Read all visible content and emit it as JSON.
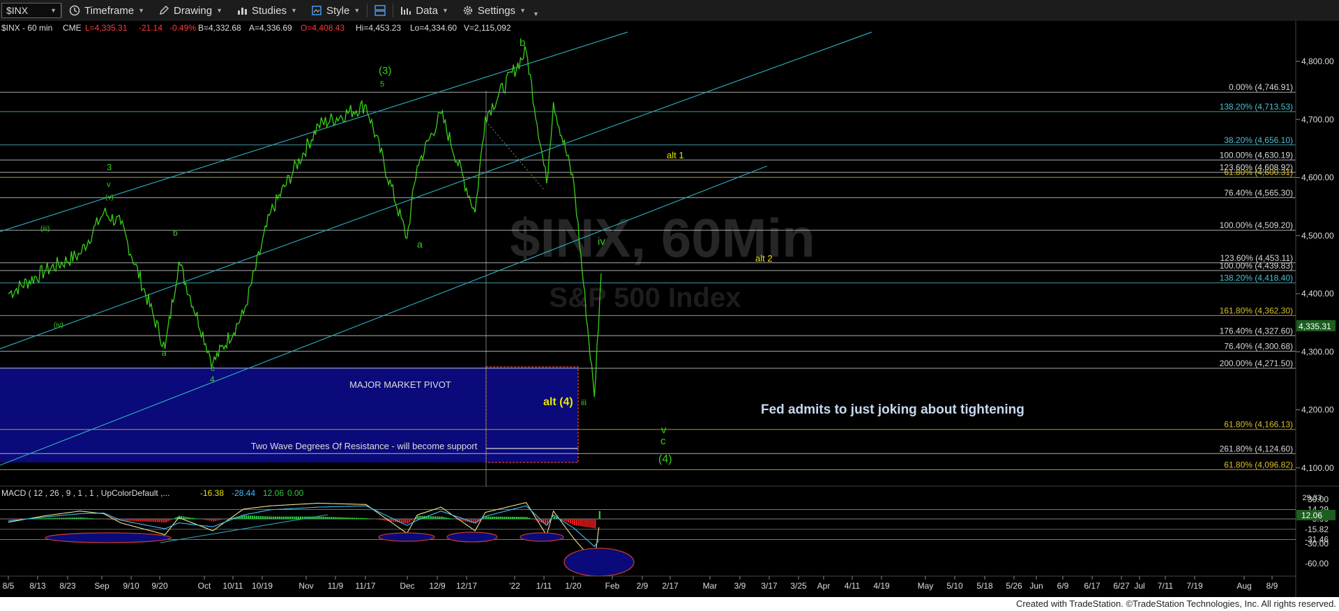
{
  "toolbar": {
    "symbol": "$INX",
    "timeframe": "Timeframe",
    "drawing": "Drawing",
    "studies": "Studies",
    "style": "Style",
    "data": "Data",
    "settings": "Settings"
  },
  "header_line": {
    "symbol": "$INX - 60 min",
    "exchange": "CME",
    "last": "L=4,335.31",
    "change": "-21.14",
    "change_pct": "-0.49%",
    "bid": "B=4,332.68",
    "ask": "A=4,336.69",
    "open": "O=4,408.43",
    "high": "Hi=4,453.23",
    "low": "Lo=4,334.60",
    "volume": "V=2,115,092"
  },
  "watermark": {
    "line1": "$INX, 60Min",
    "line2": "S&P 500 Index"
  },
  "colors": {
    "background": "#000000",
    "price": "#39d017",
    "wave_label": "#39d017",
    "alt_label": "#e6e600",
    "channel": "#2aa6b8",
    "pivot_box": "#0a0a7a",
    "pivot_border": "#c0392b",
    "fib_white": "#d8d8d8",
    "fib_cyan": "#4fc0d0",
    "fib_yellow": "#d7c02a",
    "macd_line": "#3fbfff",
    "macd_signal": "#f0e68c",
    "hist_up": "#2ecc40",
    "hist_down": "#e82020"
  },
  "price_axis": {
    "labels": [
      "4,800.00",
      "4,700.00",
      "4,600.00",
      "4,500.00",
      "4,400.00",
      "4,300.00",
      "4,200.00",
      "4,100.00"
    ],
    "current": "4,335.31"
  },
  "macd_axis": {
    "labels": [
      "30.00",
      "14.29",
      "0.00",
      "-15.82",
      "-31.46",
      "-30.00",
      "-60.00"
    ],
    "current": "12.06",
    "top_cut": "29.33"
  },
  "macd_header": {
    "title": "MACD ( 12 , 26 , 9 , 1 , 1 , UpColorDefault ,...",
    "macd": "-16.38",
    "signal": "-28.44",
    "hist": "12.06",
    "zero": "0.00"
  },
  "date_axis": [
    "8/5",
    "8/13",
    "8/23",
    "Sep",
    "9/10",
    "9/20",
    "Oct",
    "10/11",
    "10/19",
    "Nov",
    "11/9",
    "11/17",
    "Dec",
    "12/9",
    "12/17",
    "'22",
    "1/11",
    "1/20",
    "Feb",
    "2/9",
    "2/17",
    "Mar",
    "3/9",
    "3/17",
    "3/25",
    "Apr",
    "4/11",
    "4/19",
    "May",
    "5/10",
    "5/18",
    "5/26",
    "Jun",
    "6/9",
    "6/17",
    "6/27",
    "Jul",
    "7/11",
    "7/19",
    "Aug",
    "8/9"
  ],
  "fib_levels": [
    {
      "text": "0.00% (4,746.91)",
      "value": 4746.91,
      "color": "white"
    },
    {
      "text": "138.20% (4,713.53)",
      "value": 4713.53,
      "color": "cyan"
    },
    {
      "text": "38.20% (4,656.10)",
      "value": 4656.1,
      "color": "cyan"
    },
    {
      "text": "100.00% (4,630.19)",
      "value": 4630.19,
      "color": "white"
    },
    {
      "text": "123.60% (4,608.92)",
      "value": 4608.92,
      "color": "white"
    },
    {
      "text": "61.80% (4,600.31)",
      "value": 4600.31,
      "color": "yellow"
    },
    {
      "text": "76.40% (4,565.30)",
      "value": 4565.3,
      "color": "white"
    },
    {
      "text": "100.00% (4,509.20)",
      "value": 4509.2,
      "color": "white"
    },
    {
      "text": "123.60% (4,453.11)",
      "value": 4453.11,
      "color": "white"
    },
    {
      "text": "100.00% (4,439.83)",
      "value": 4439.83,
      "color": "white"
    },
    {
      "text": "138.20% (4,418.40)",
      "value": 4418.4,
      "color": "cyan"
    },
    {
      "text": "161.80% (4,362.30)",
      "value": 4362.3,
      "color": "yellow"
    },
    {
      "text": "176.40% (4,327.60)",
      "value": 4327.6,
      "color": "white"
    },
    {
      "text": "76.40% (4,300.68)",
      "value": 4300.68,
      "color": "white"
    },
    {
      "text": "200.00% (4,271.50)",
      "value": 4271.5,
      "color": "white"
    },
    {
      "text": "61.80% (4,166.13)",
      "value": 4166.13,
      "color": "yellow"
    },
    {
      "text": "261.80% (4,124.60)",
      "value": 4124.6,
      "color": "white"
    },
    {
      "text": "61.80% (4,096.82)",
      "value": 4096.82,
      "color": "yellow"
    }
  ],
  "annotations": {
    "pivot_title": "MAJOR MARKET PIVOT",
    "pivot_sub": "Two Wave Degrees Of Resistance - will become support",
    "alt1": "alt 1",
    "alt2": "alt 2",
    "alt4": "alt (4)",
    "headline": "Fed admits to just joking about tightening",
    "w_b": "b",
    "w_3paren": "(3)",
    "w_5": "5",
    "w_3": "3",
    "w_v": "v",
    "w_vparen": "(v)",
    "w_iii": "(iii)",
    "w_iv": "(iv)",
    "w_b2": "b",
    "w_a1": "a",
    "w_c": "c",
    "w_4": "4",
    "w_a2": "a",
    "w_iv2": "iv",
    "w_iii2": "iii",
    "w_v2": "v",
    "w_c2": "c",
    "w_4paren": "(4)"
  },
  "footer": "Created with TradeStation. ©TradeStation Technologies, Inc. All rights reserved.",
  "chart_data": {
    "type": "line",
    "title": "$INX - 60 min",
    "y_unit": "index points",
    "ylim": [
      4060,
      4860
    ],
    "x": [
      "2021-08-05",
      "2021-08-16",
      "2021-08-26",
      "2021-09-02",
      "2021-09-07",
      "2021-09-20",
      "2021-09-24",
      "2021-10-04",
      "2021-10-13",
      "2021-10-21",
      "2021-11-04",
      "2021-11-18",
      "2021-11-30",
      "2021-12-03",
      "2021-12-10",
      "2021-12-20",
      "2021-12-23",
      "2022-01-04",
      "2022-01-10",
      "2022-01-12",
      "2022-01-18",
      "2022-01-24",
      "2022-01-26"
    ],
    "series": [
      {
        "values": [
          4400,
          4440,
          4468,
          4540,
          4520,
          4305,
          4455,
          4280,
          4365,
          4540,
          4690,
          4725,
          4495,
          4620,
          4710,
          4540,
          4705,
          4818,
          4590,
          4730,
          4590,
          4222,
          4435
        ]
      }
    ],
    "macd": {
      "ylim": [
        -70,
        30
      ],
      "macd_line": [
        -5,
        5,
        12,
        8,
        -6,
        -24,
        2,
        -18,
        15,
        20,
        24,
        22,
        -22,
        6,
        18,
        -18,
        10,
        25,
        -25,
        12,
        -30,
        -66,
        14
      ],
      "signal_line": [
        -3,
        3,
        8,
        9,
        -2,
        -15,
        -6,
        -12,
        6,
        14,
        18,
        20,
        -10,
        -2,
        12,
        -6,
        4,
        20,
        -10,
        6,
        -14,
        -42,
        -28
      ]
    }
  }
}
